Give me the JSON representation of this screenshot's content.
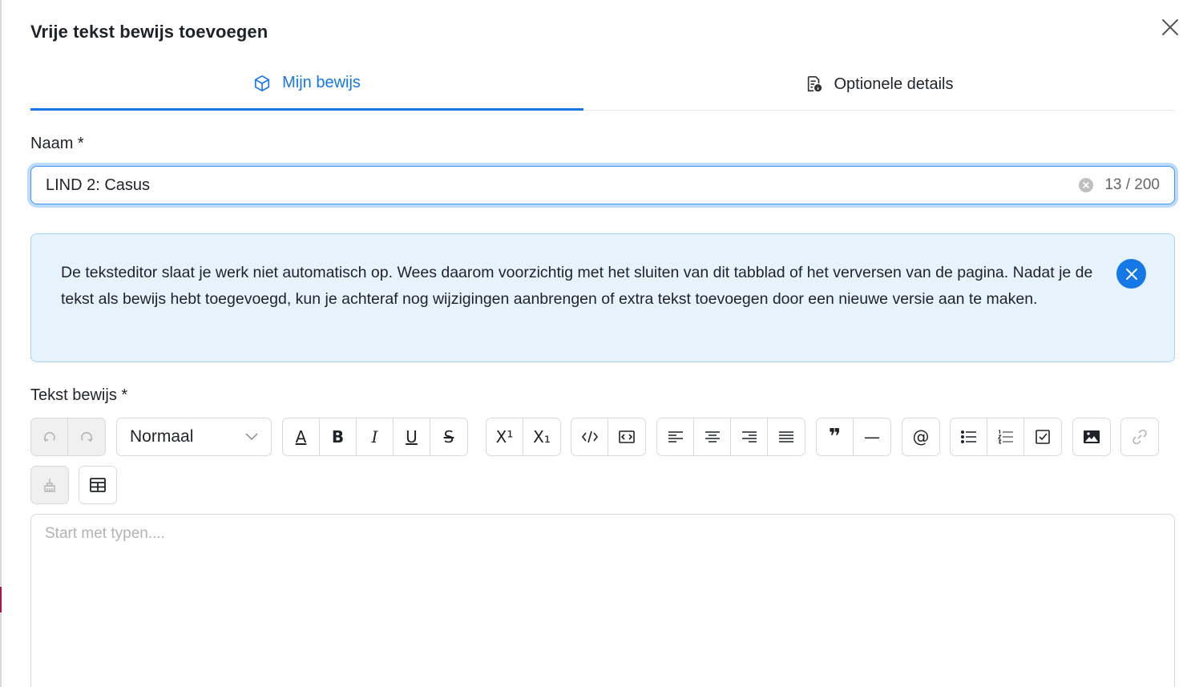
{
  "dialog": {
    "title": "Vrije tekst bewijs toevoegen"
  },
  "tabs": [
    {
      "label": "Mijn bewijs",
      "icon": "cube-icon",
      "active": true
    },
    {
      "label": "Optionele details",
      "icon": "document-info-icon",
      "active": false
    }
  ],
  "name_field": {
    "label": "Naam *",
    "value": "LIND 2: Casus",
    "counter": "13 / 200"
  },
  "alert": {
    "text": "De teksteditor slaat je werk niet automatisch op. Wees daarom voorzichtig met het sluiten van dit tabblad of het verversen van de pagina. Nadat je de tekst als bewijs hebt toegevoegd, kun je achteraf nog wijzigingen aanbrengen of extra tekst toevoegen door een nieuwe versie aan te maken."
  },
  "editor": {
    "label": "Tekst bewijs *",
    "heading_select": "Normaal",
    "placeholder": "Start met typen....",
    "toolbar": {
      "bold": "B",
      "italic": "I",
      "underline": "U",
      "strike": "S",
      "superscript": "X¹",
      "subscript": "X₁",
      "font_color": "A",
      "mention": "@",
      "quote": "❞",
      "hr": "—"
    }
  },
  "colors": {
    "accent": "#1677e6",
    "alert_bg": "#e6f3fd",
    "alert_border": "#a8d3f5",
    "border": "#d9d9d9"
  }
}
